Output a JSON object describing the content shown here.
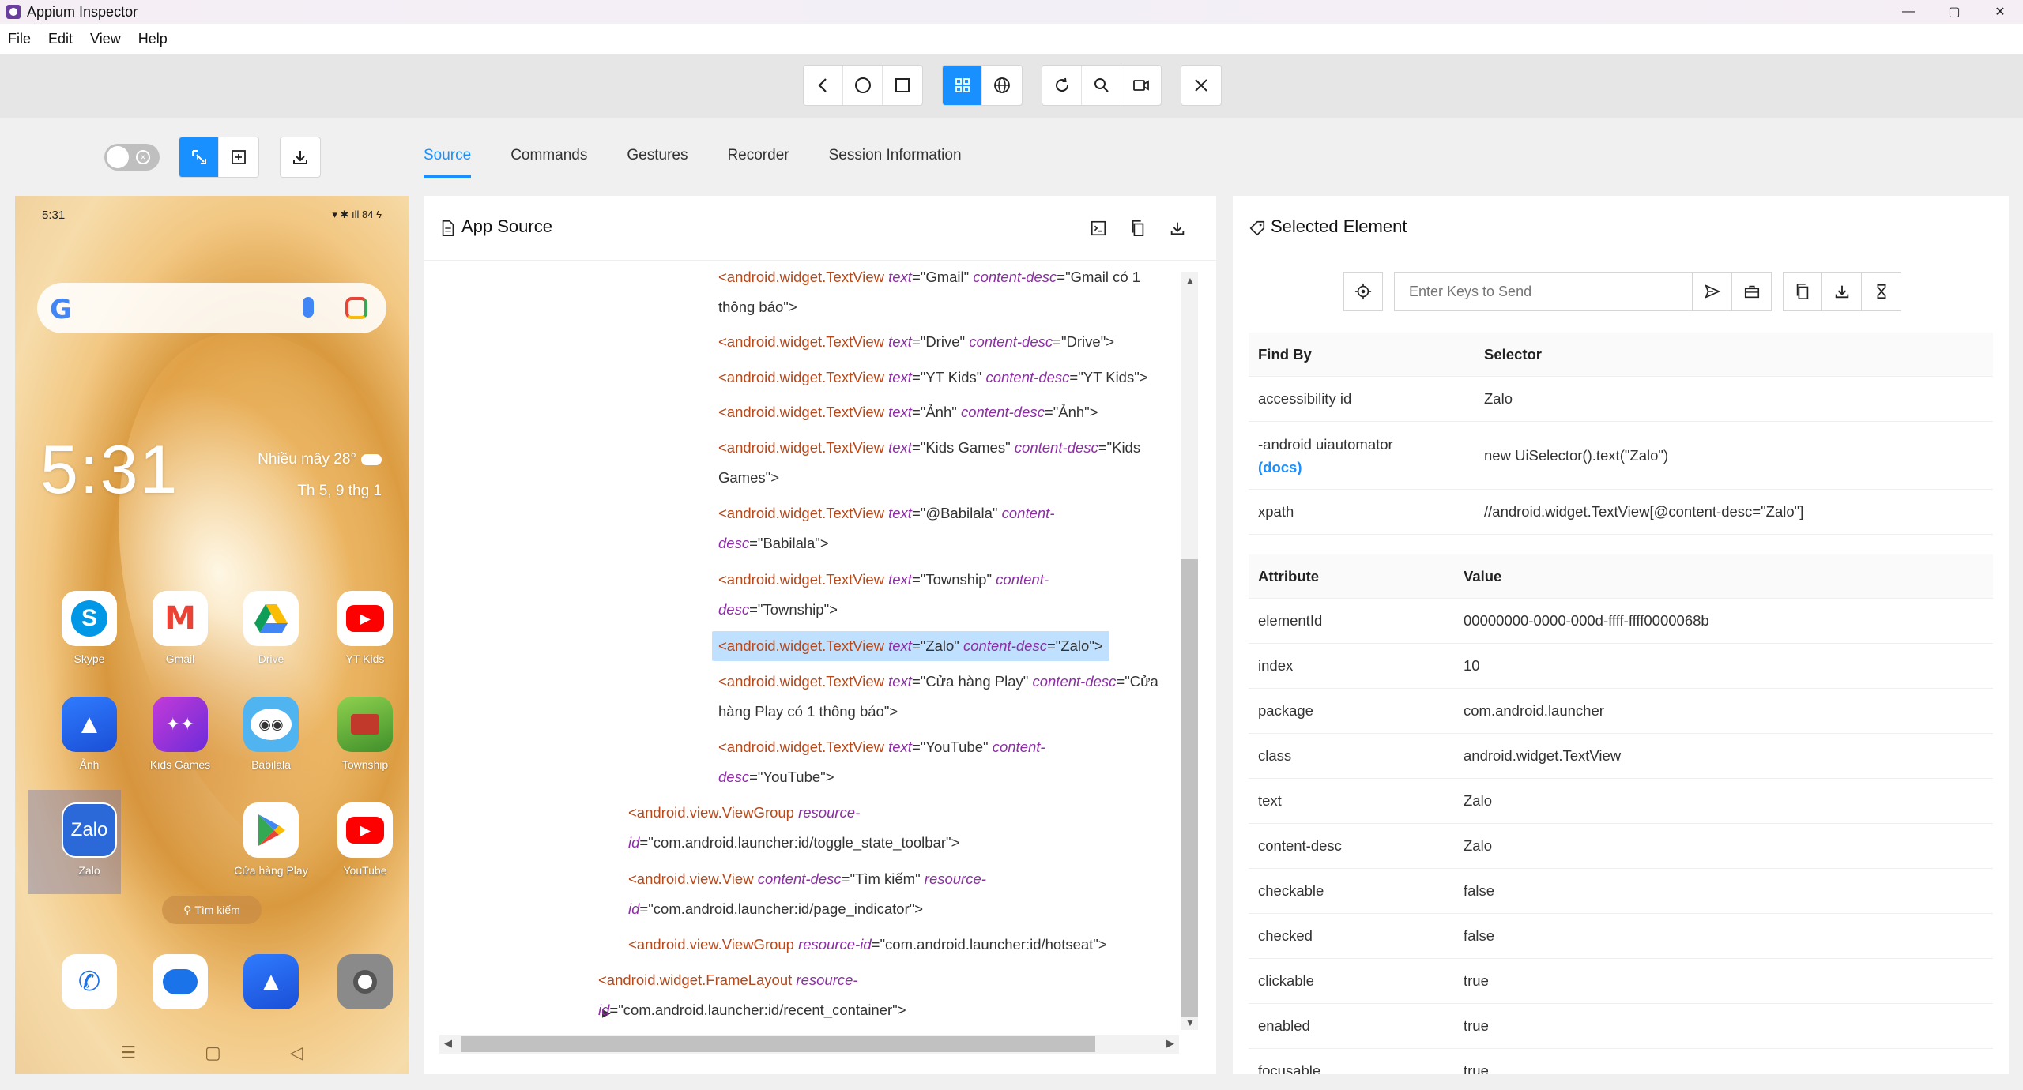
{
  "window": {
    "title": "Appium Inspector",
    "controls": [
      "—",
      "▢",
      "✕"
    ]
  },
  "menu": [
    "File",
    "Edit",
    "View",
    "Help"
  ],
  "tabs": [
    "Source",
    "Commands",
    "Gestures",
    "Recorder",
    "Session Information"
  ],
  "phone": {
    "status_time": "5:31",
    "status_right": "▾ ✱ ıll 84 ϟ",
    "clock": "5:31",
    "weather_line1": "Nhiều mây 28°",
    "weather_line2": "Th 5, 9 thg 1",
    "google_letter": "G",
    "apps_row1": [
      "Skype",
      "Gmail",
      "Drive",
      "YT Kids"
    ],
    "apps_row2": [
      "Ảnh",
      "Kids Games",
      "Babilala",
      "Township"
    ],
    "apps_row3": [
      "Zalo",
      "Cửa hàng Play",
      "YouTube"
    ],
    "icon_text": {
      "skype": "S",
      "gmail": "M",
      "zalo": "Zalo"
    },
    "search_pill": "Tìm kiếm",
    "nav": [
      "☰",
      "▢",
      "◁"
    ]
  },
  "app_source": {
    "title": "App Source",
    "nodes": [
      {
        "tag": "<android.widget.TextView",
        "attrs": [
          [
            "text",
            "\"Gmail\""
          ],
          [
            "content-desc",
            "\"Gmail có 1"
          ]
        ],
        "cont": "thông báo\">"
      },
      {
        "tag": "<android.widget.TextView",
        "attrs": [
          [
            "text",
            "\"Drive\""
          ],
          [
            "content-desc",
            "\"Drive\">"
          ]
        ]
      },
      {
        "tag": "<android.widget.TextView",
        "attrs": [
          [
            "text",
            "\"YT Kids\""
          ],
          [
            "content-desc",
            "\"YT Kids\">"
          ]
        ]
      },
      {
        "tag": "<android.widget.TextView",
        "attrs": [
          [
            "text",
            "\"Ảnh\""
          ],
          [
            "content-desc",
            "\"Ảnh\">"
          ]
        ]
      },
      {
        "tag": "<android.widget.TextView",
        "attrs": [
          [
            "text",
            "\"Kids Games\""
          ],
          [
            "content-desc",
            "\"Kids"
          ]
        ],
        "cont": "Games\">"
      },
      {
        "tag": "<android.widget.TextView",
        "attrs": [
          [
            "text",
            "\"@Babilala\""
          ],
          [
            "content-",
            ""
          ]
        ],
        "cont_attr": "desc",
        "cont": "=\"Babilala\">"
      },
      {
        "tag": "<android.widget.TextView",
        "attrs": [
          [
            "text",
            "\"Township\""
          ],
          [
            "content-",
            ""
          ]
        ],
        "cont_attr": "desc",
        "cont": "=\"Township\">"
      },
      {
        "tag": "<android.widget.TextView",
        "attrs": [
          [
            "text",
            "\"Zalo\""
          ],
          [
            "content-desc",
            "\"Zalo\">"
          ]
        ],
        "selected": true
      },
      {
        "tag": "<android.widget.TextView",
        "attrs": [
          [
            "text",
            "\"Cửa hàng Play\""
          ],
          [
            "content-desc",
            "\"Cửa"
          ]
        ],
        "cont": "hàng Play có 1 thông báo\">"
      },
      {
        "tag": "<android.widget.TextView",
        "attrs": [
          [
            "text",
            "\"YouTube\""
          ],
          [
            "content-",
            ""
          ]
        ],
        "cont_attr": "desc",
        "cont": "=\"YouTube\">"
      },
      {
        "tag": "<android.view.ViewGroup",
        "attrs": [
          [
            "resource-",
            ""
          ]
        ],
        "cont_attr": "id",
        "cont": "=\"com.android.launcher:id/toggle_state_toolbar\">"
      },
      {
        "tag": "<android.view.View",
        "attrs": [
          [
            "content-desc",
            "\"Tìm kiếm\""
          ],
          [
            "resource-",
            ""
          ]
        ],
        "cont_attr": "id",
        "cont": "=\"com.android.launcher:id/page_indicator\">"
      },
      {
        "tag": "<android.view.ViewGroup",
        "attrs": [
          [
            "resource-id",
            "\"com.android.launcher:id/hotseat\">"
          ]
        ],
        "collapsed": true
      },
      {
        "tag": "<android.widget.FrameLayout",
        "attrs": [
          [
            "resource-",
            ""
          ]
        ],
        "cont_attr": "id",
        "cont": "=\"com.android.launcher:id/recent_container\">"
      }
    ]
  },
  "selected_element": {
    "title": "Selected Element",
    "keys_placeholder": "Enter Keys to Send",
    "find_by_header": [
      "Find By",
      "Selector"
    ],
    "find_by": [
      {
        "by": "accessibility id",
        "selector": "Zalo"
      },
      {
        "by": "-android uiautomator",
        "docs": "(docs)",
        "selector": "new UiSelector().text(\"Zalo\")"
      },
      {
        "by": "xpath",
        "selector": "//android.widget.TextView[@content-desc=\"Zalo\"]"
      }
    ],
    "attr_header": [
      "Attribute",
      "Value"
    ],
    "attributes": [
      {
        "name": "elementId",
        "value": "00000000-0000-000d-ffff-ffff0000068b"
      },
      {
        "name": "index",
        "value": "10"
      },
      {
        "name": "package",
        "value": "com.android.launcher"
      },
      {
        "name": "class",
        "value": "android.widget.TextView"
      },
      {
        "name": "text",
        "value": "Zalo"
      },
      {
        "name": "content-desc",
        "value": "Zalo"
      },
      {
        "name": "checkable",
        "value": "false"
      },
      {
        "name": "checked",
        "value": "false"
      },
      {
        "name": "clickable",
        "value": "true"
      },
      {
        "name": "enabled",
        "value": "true"
      },
      {
        "name": "focusable",
        "value": "true"
      }
    ]
  },
  "colors": {
    "accent": "#1890ff",
    "tag": "#b4491c",
    "attr": "#8b2fa3",
    "selected_row": "#bfe0ff"
  }
}
